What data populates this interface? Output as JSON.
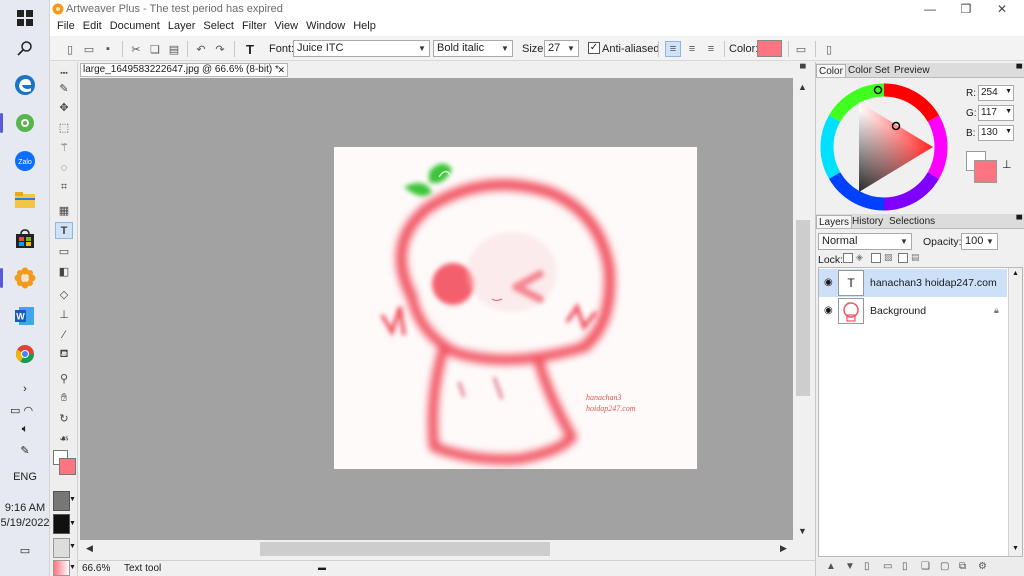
{
  "taskbar": {
    "time": "9:16 AM",
    "date": "5/19/2022",
    "language": "ENG"
  },
  "app": {
    "title": "Artweaver Plus - The test period has expired"
  },
  "menu": [
    "File",
    "Edit",
    "Document",
    "Layer",
    "Select",
    "Filter",
    "View",
    "Window",
    "Help"
  ],
  "toolbar": {
    "font_label": "Font:",
    "font_value": "Juice ITC",
    "style_value": "Bold italic",
    "size_label": "Size:",
    "size_value": "27",
    "antialias_label": "Anti-aliased",
    "color_label": "Color:",
    "color_value": "#fe7582"
  },
  "document": {
    "tab_title": "large_1649583222647.jpg @ 66.6% (8-bit) *",
    "watermark_line1": "hanachan3",
    "watermark_line2": "hoidap247.com"
  },
  "status": {
    "zoom": "66.6%",
    "tool": "Text tool"
  },
  "color_panel": {
    "tabs": [
      "Color",
      "Color Set",
      "Preview"
    ],
    "r_label": "R:",
    "g_label": "G:",
    "b_label": "B:",
    "r": "254",
    "g": "117",
    "b": "130"
  },
  "layers_panel": {
    "tabs": [
      "Layers",
      "History",
      "Selections"
    ],
    "blend_mode": "Normal",
    "opacity_label": "Opacity:",
    "opacity_value": "100",
    "lock_label": "Lock:",
    "layers": [
      {
        "name": "hanachan3 hoidap247.com",
        "thumb": "T"
      },
      {
        "name": "Background",
        "thumb": ""
      }
    ]
  }
}
